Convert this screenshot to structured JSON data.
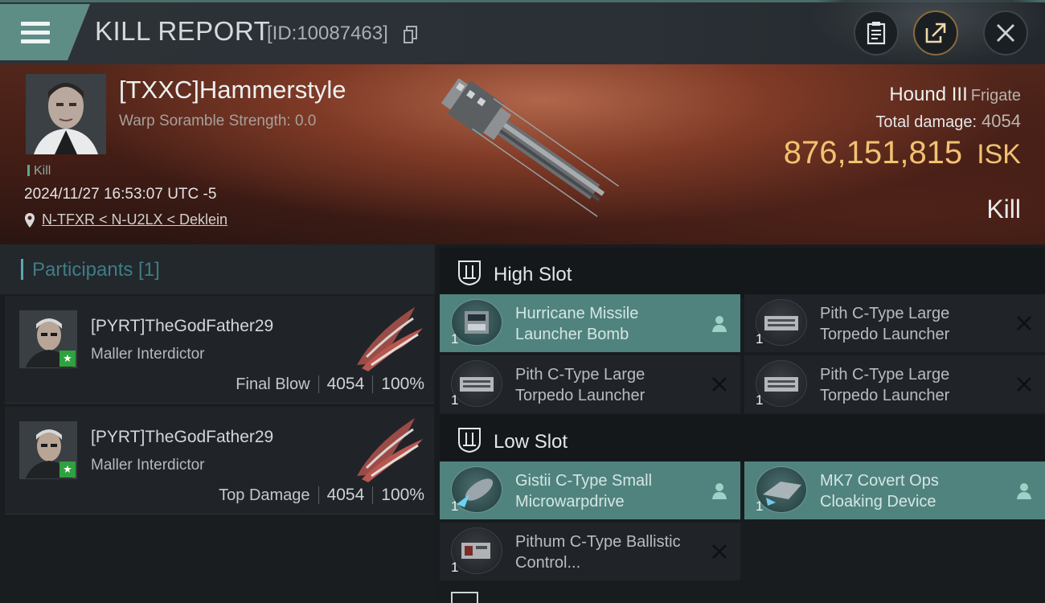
{
  "header": {
    "title": "KILL REPORT",
    "report_id": "[ID:10087463]"
  },
  "victim": {
    "name": "[TXXC]Hammerstyle",
    "scramble": "Warp Soramble Strength: 0.0",
    "tag": "Kill",
    "datetime": "2024/11/27 16:53:07 UTC -5",
    "location": "N-TFXR < N-U2LX < Deklein",
    "ship_name": "Hound III",
    "ship_class": "Frigate",
    "total_damage_label": "Total damage:",
    "total_damage": "4054",
    "isk_value": "876,151,815",
    "isk_unit": "ISK",
    "result": "Kill"
  },
  "participants": {
    "label": "Participants [1]",
    "items": [
      {
        "name": "[PYRT]TheGodFather29",
        "ship": "Maller Interdictor",
        "role": "Final Blow",
        "damage": "4054",
        "percent": "100%"
      },
      {
        "name": "[PYRT]TheGodFather29",
        "ship": "Maller Interdictor",
        "role": "Top Damage",
        "damage": "4054",
        "percent": "100%"
      }
    ]
  },
  "fitting": {
    "high_slot": {
      "label": "High Slot",
      "modules": [
        {
          "name": "Hurricane Missile Launcher Bomb",
          "qty": "1",
          "active": true,
          "action_icon": "person-icon"
        },
        {
          "name": "Pith C-Type Large Torpedo Launcher",
          "qty": "1",
          "active": false,
          "action_icon": "close-icon"
        },
        {
          "name": "Pith C-Type Large Torpedo Launcher",
          "qty": "1",
          "active": false,
          "action_icon": "close-icon"
        },
        {
          "name": "Pith C-Type Large Torpedo Launcher",
          "qty": "1",
          "active": false,
          "action_icon": "close-icon"
        }
      ]
    },
    "low_slot": {
      "label": "Low Slot",
      "modules": [
        {
          "name": "Gistii C-Type Small Microwarpdrive",
          "qty": "1",
          "active": true,
          "action_icon": "person-icon"
        },
        {
          "name": "MK7 Covert Ops Cloaking Device",
          "qty": "1",
          "active": true,
          "action_icon": "person-icon"
        },
        {
          "name": "Pithum C-Type Ballistic Control...",
          "qty": "1",
          "active": false,
          "action_icon": "close-icon"
        }
      ]
    }
  },
  "colors": {
    "accent_teal": "#50837e",
    "isk_gold": "#f2c271",
    "badge_green": "#2fa13f"
  }
}
